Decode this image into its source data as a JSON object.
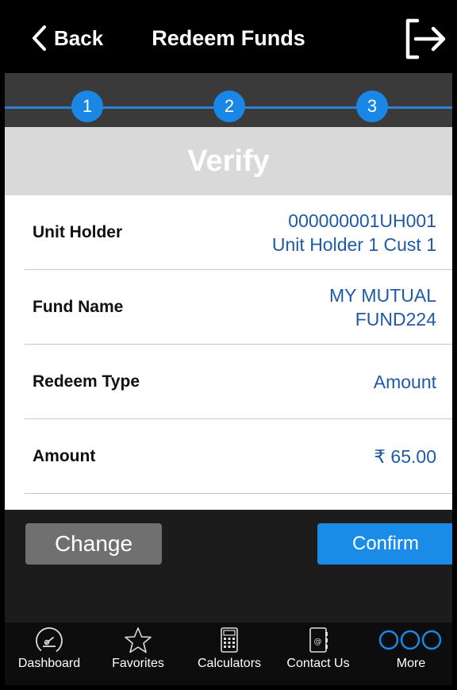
{
  "header": {
    "back_label": "Back",
    "title": "Redeem Funds",
    "logout_icon": "logout-icon"
  },
  "stepper": {
    "steps": [
      "1",
      "2",
      "3"
    ],
    "accent": "#1a86e6"
  },
  "banner": {
    "title": "Verify"
  },
  "rows": [
    {
      "label": "Unit Holder",
      "value_lines": [
        "000000001UH001",
        "Unit Holder 1 Cust 1"
      ]
    },
    {
      "label": "Fund Name",
      "value_lines": [
        "MY MUTUAL",
        "FUND224"
      ]
    },
    {
      "label": "Redeem Type",
      "value_lines": [
        "Amount"
      ]
    },
    {
      "label": "Amount",
      "value_lines": [
        "₹ 65.00"
      ]
    }
  ],
  "actions": {
    "change_label": "Change",
    "confirm_label": "Confirm"
  },
  "tabbar": {
    "tabs": [
      {
        "label": "Dashboard",
        "icon": "speedometer-icon"
      },
      {
        "label": "Favorites",
        "icon": "star-icon"
      },
      {
        "label": "Calculators",
        "icon": "calculator-icon"
      },
      {
        "label": "Contact Us",
        "icon": "contact-book-icon"
      },
      {
        "label": "More",
        "icon": "more-dots-icon"
      }
    ]
  },
  "colors": {
    "value_text": "#1f5aa6",
    "confirm": "#1a8ce8",
    "change": "#707070"
  }
}
